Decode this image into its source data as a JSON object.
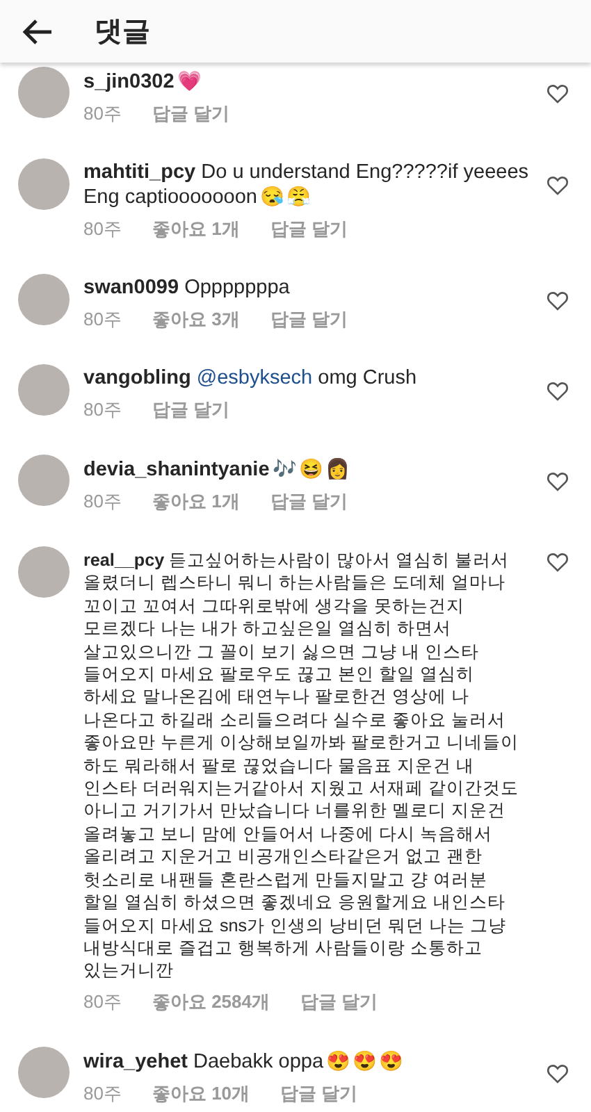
{
  "header": {
    "title": "댓글"
  },
  "comments": [
    {
      "username": "s_jin0302",
      "emojis": [
        "💗"
      ],
      "time": "80주",
      "reply": "답글 달기"
    },
    {
      "username": "mahtiti_pcy",
      "text": "Do u understand Eng?????if yeeees\nEng captiooooooon",
      "emojis": [
        "😪",
        "😤"
      ],
      "time": "80주",
      "likes": "좋아요 1개",
      "reply": "답글 달기"
    },
    {
      "username": "swan0099",
      "text": "Opppppppa",
      "time": "80주",
      "likes": "좋아요 3개",
      "reply": "답글 달기"
    },
    {
      "username": "vangobling",
      "mention": "@esbyksech",
      "text": "omg Crush",
      "time": "80주",
      "reply": "답글 달기"
    },
    {
      "username": "devia_shanintyanie",
      "emojis": [
        "🎶",
        "😆",
        "👩"
      ],
      "time": "80주",
      "likes": "좋아요 1개",
      "reply": "답글 달기"
    },
    {
      "username": "real__pcy",
      "text": "듣고싶어하는사람이 많아서 열심히 불러서\n올렸더니 렙스타니 뭐니 하는사람들은 도데체 얼마나\n꼬이고 꼬여서 그따위로밖에 생각을 못하는건지\n모르겠다 나는 내가 하고싶은일 열심히 하면서\n살고있으니깐 그 꼴이 보기 싫으면 그냥 내 인스타\n들어오지 마세요 팔로우도 끊고 본인 할일 열심히\n하세요 말나온김에 태연누나 팔로한건 영상에 나\n나온다고 하길래 소리들으려다 실수로 좋아요 눌러서\n좋아요만 누른게 이상해보일까봐 팔로한거고 니네들이\n하도 뭐라해서 팔로 끊었습니다 물음표 지운건 내\n인스타 더러워지는거같아서 지웠고 서재페 같이간것도\n아니고 거기가서 만났습니다 너를위한 멜로디 지운건\n올려놓고 보니 맘에 안들어서 나중에 다시 녹음해서\n올리려고 지운거고 비공개인스타같은거 없고 괜한\n헛소리로 내팬들 혼란스럽게 만들지말고 걍 여러분\n할일 열심히 하셨으면 좋겠네요 응원할게요 내인스타\n들어오지 마세요 sns가 인생의 낭비던 뭐던 나는 그냥\n내방식대로 즐겁고 행복하게 사람들이랑 소통하고\n있는거니깐",
      "time": "80주",
      "likes": "좋아요 2584개",
      "reply": "답글 달기"
    },
    {
      "username": "wira_yehet",
      "text": "Daebakk oppa",
      "emojis": [
        "😍",
        "😍",
        "😍"
      ],
      "time": "80주",
      "likes": "좋아요 10개",
      "reply": "답글 달기"
    }
  ]
}
